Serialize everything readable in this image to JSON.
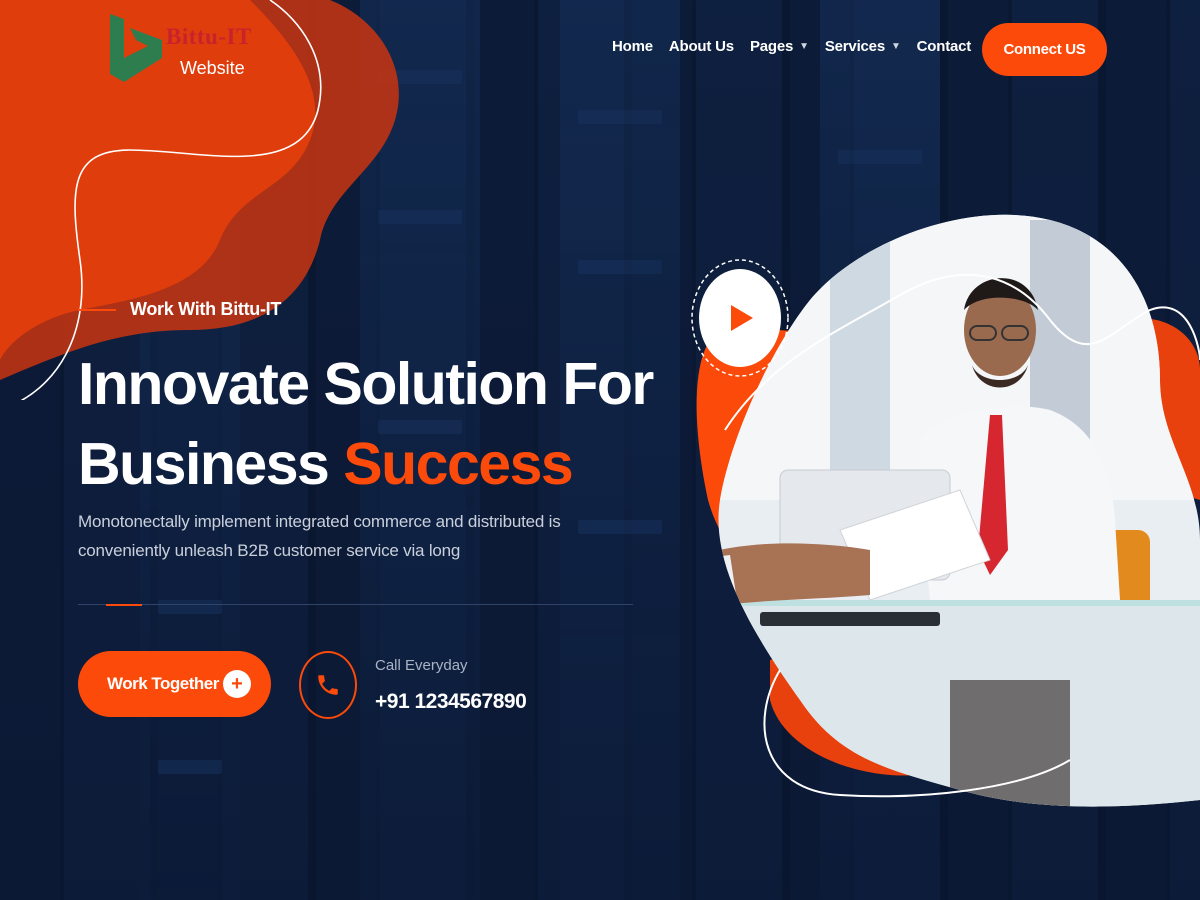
{
  "logo": {
    "title": "Bittu-IT",
    "subtitle": "Website",
    "icon": "bing-b-logo-icon",
    "colors": {
      "primary": "#c8232d",
      "icon": "#2e7d4f"
    }
  },
  "nav": {
    "items": [
      {
        "label": "Home",
        "has_dropdown": false
      },
      {
        "label": "About Us",
        "has_dropdown": false
      },
      {
        "label": "Pages",
        "has_dropdown": true
      },
      {
        "label": "Services",
        "has_dropdown": true
      },
      {
        "label": "Contact",
        "has_dropdown": false
      }
    ],
    "cta_label": "Connect US"
  },
  "hero": {
    "eyebrow": "Work With Bittu-IT",
    "title_line1": "Innovate Solution For",
    "title_line2_plain": "Business ",
    "title_line2_accent": "Success",
    "description": "Monotonectally implement integrated commerce and distributed is conveniently unleash B2B customer service via long",
    "primary_button": "Work Together",
    "primary_button_icon": "plus-icon",
    "call_label": "Call Everyday",
    "call_number": "+91 1234567890",
    "call_icon": "phone-icon",
    "play_icon": "play-icon"
  },
  "colors": {
    "accent": "#fc4a0a",
    "background": "#0d1a33",
    "text": "#ffffff",
    "muted_text": "#c9cfdb"
  }
}
